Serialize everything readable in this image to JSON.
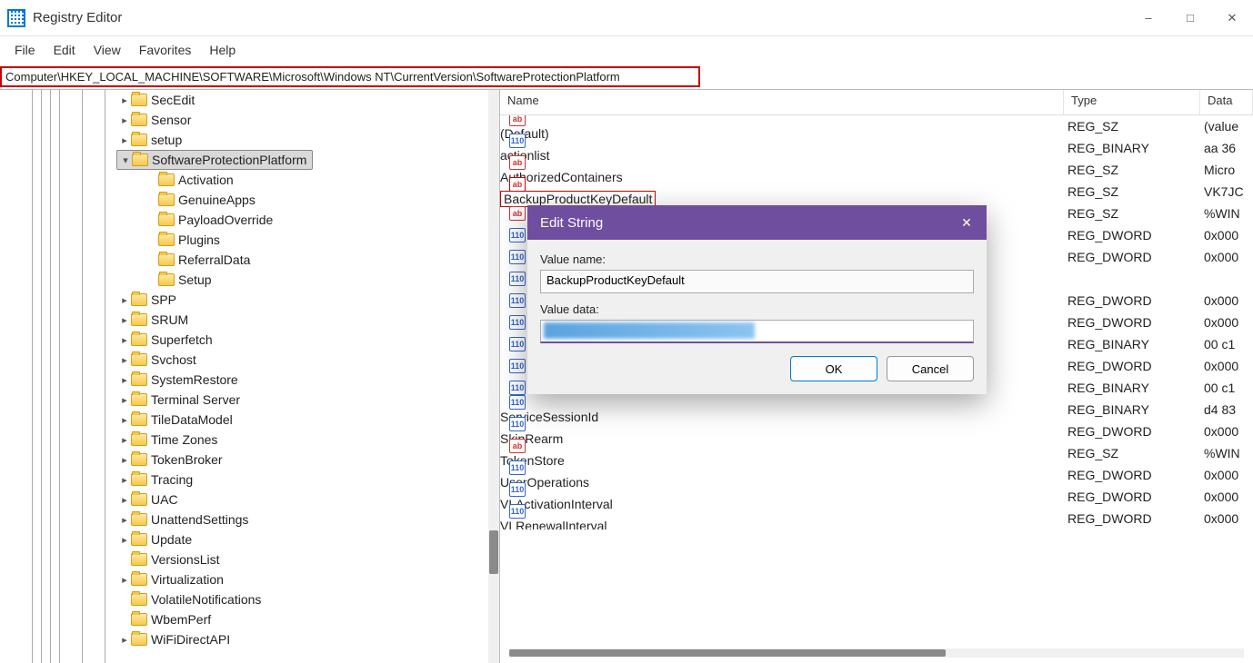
{
  "window": {
    "title": "Registry Editor"
  },
  "menu": {
    "file": "File",
    "edit": "Edit",
    "view": "View",
    "favorites": "Favorites",
    "help": "Help"
  },
  "address": "Computer\\HKEY_LOCAL_MACHINE\\SOFTWARE\\Microsoft\\Windows NT\\CurrentVersion\\SoftwareProtectionPlatform",
  "tree": [
    {
      "indent": 130,
      "caret": ">",
      "label": "SecEdit"
    },
    {
      "indent": 130,
      "caret": ">",
      "label": "Sensor"
    },
    {
      "indent": 130,
      "caret": ">",
      "label": "setup"
    },
    {
      "indent": 130,
      "caret": "v",
      "label": "SoftwareProtectionPlatform",
      "selected": true
    },
    {
      "indent": 160,
      "caret": "",
      "label": "Activation"
    },
    {
      "indent": 160,
      "caret": "",
      "label": "GenuineApps"
    },
    {
      "indent": 160,
      "caret": "",
      "label": "PayloadOverride"
    },
    {
      "indent": 160,
      "caret": "",
      "label": "Plugins"
    },
    {
      "indent": 160,
      "caret": "",
      "label": "ReferralData"
    },
    {
      "indent": 160,
      "caret": "",
      "label": "Setup"
    },
    {
      "indent": 130,
      "caret": ">",
      "label": "SPP"
    },
    {
      "indent": 130,
      "caret": ">",
      "label": "SRUM"
    },
    {
      "indent": 130,
      "caret": ">",
      "label": "Superfetch"
    },
    {
      "indent": 130,
      "caret": ">",
      "label": "Svchost"
    },
    {
      "indent": 130,
      "caret": ">",
      "label": "SystemRestore"
    },
    {
      "indent": 130,
      "caret": ">",
      "label": "Terminal Server"
    },
    {
      "indent": 130,
      "caret": ">",
      "label": "TileDataModel"
    },
    {
      "indent": 130,
      "caret": ">",
      "label": "Time Zones"
    },
    {
      "indent": 130,
      "caret": ">",
      "label": "TokenBroker"
    },
    {
      "indent": 130,
      "caret": ">",
      "label": "Tracing"
    },
    {
      "indent": 130,
      "caret": ">",
      "label": "UAC"
    },
    {
      "indent": 130,
      "caret": ">",
      "label": "UnattendSettings"
    },
    {
      "indent": 130,
      "caret": ">",
      "label": "Update"
    },
    {
      "indent": 130,
      "caret": "",
      "label": "VersionsList"
    },
    {
      "indent": 130,
      "caret": ">",
      "label": "Virtualization"
    },
    {
      "indent": 130,
      "caret": "",
      "label": "VolatileNotifications"
    },
    {
      "indent": 130,
      "caret": "",
      "label": "WbemPerf"
    },
    {
      "indent": 130,
      "caret": ">",
      "label": "WiFiDirectAPI"
    }
  ],
  "columns": {
    "name": "Name",
    "type": "Type",
    "data": "Data"
  },
  "values": [
    {
      "icon": "str",
      "name": "(Default)",
      "type": "REG_SZ",
      "data": "(value"
    },
    {
      "icon": "bin",
      "name": "actionlist",
      "type": "REG_BINARY",
      "data": "aa 36"
    },
    {
      "icon": "str",
      "name": "AuthorizedContainers",
      "type": "REG_SZ",
      "data": "Micro"
    },
    {
      "icon": "str",
      "name": "BackupProductKeyDefault",
      "type": "REG_SZ",
      "data": "VK7JC",
      "highlight": true
    },
    {
      "icon": "str",
      "name": "",
      "type": "REG_SZ",
      "data": "%WIN"
    },
    {
      "icon": "bin",
      "name": "",
      "type": "REG_DWORD",
      "data": "0x000"
    },
    {
      "icon": "bin",
      "name": "",
      "type": "REG_DWORD",
      "data": "0x000"
    },
    {
      "icon": "bin",
      "name": "",
      "type": "",
      "data": ""
    },
    {
      "icon": "bin",
      "name": "",
      "type": "REG_DWORD",
      "data": "0x000"
    },
    {
      "icon": "bin",
      "name": "",
      "type": "REG_DWORD",
      "data": "0x000"
    },
    {
      "icon": "bin",
      "name": "",
      "type": "REG_BINARY",
      "data": "00 c1"
    },
    {
      "icon": "bin",
      "name": "",
      "type": "REG_DWORD",
      "data": "0x000"
    },
    {
      "icon": "bin",
      "name": "",
      "type": "REG_BINARY",
      "data": "00 c1"
    },
    {
      "icon": "bin",
      "name": "ServiceSessionId",
      "type": "REG_BINARY",
      "data": "d4 83"
    },
    {
      "icon": "bin",
      "name": "SkipRearm",
      "type": "REG_DWORD",
      "data": "0x000"
    },
    {
      "icon": "str",
      "name": "TokenStore",
      "type": "REG_SZ",
      "data": "%WIN"
    },
    {
      "icon": "bin",
      "name": "UserOperations",
      "type": "REG_DWORD",
      "data": "0x000"
    },
    {
      "icon": "bin",
      "name": "VLActivationInterval",
      "type": "REG_DWORD",
      "data": "0x000"
    },
    {
      "icon": "bin",
      "name": "VLRenewalInterval",
      "type": "REG_DWORD",
      "data": "0x000"
    }
  ],
  "dialog": {
    "title": "Edit String",
    "value_name_label": "Value name:",
    "value_name": "BackupProductKeyDefault",
    "value_data_label": "Value data:",
    "ok": "OK",
    "cancel": "Cancel"
  }
}
